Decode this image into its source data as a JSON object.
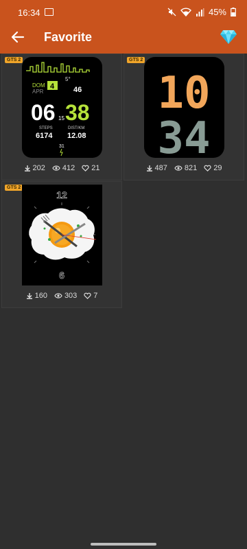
{
  "status": {
    "time": "16:34",
    "battery": "45%"
  },
  "header": {
    "title": "Favorite"
  },
  "colors": {
    "accent": "#c9531d",
    "badge": "#f0a52a"
  },
  "cards": [
    {
      "badge": "GTS 2",
      "downloads": "202",
      "views": "412",
      "likes": "21",
      "face": {
        "day": "DOM",
        "date": "4",
        "month": "APR",
        "temp": "5°",
        "heart": "46",
        "hour": "06",
        "seconds": "15",
        "minute": "38",
        "steps_label": "STEPS",
        "steps": "6174",
        "dist_label": "DIST/KM",
        "dist": "12.08",
        "day_num": "31"
      }
    },
    {
      "badge": "GTS 2",
      "downloads": "487",
      "views": "821",
      "likes": "29",
      "face": {
        "hour": "10",
        "minute": "34"
      }
    },
    {
      "badge": "GTS 2",
      "downloads": "160",
      "views": "303",
      "likes": "7",
      "face": {
        "top": "12",
        "bottom": "6"
      }
    }
  ]
}
